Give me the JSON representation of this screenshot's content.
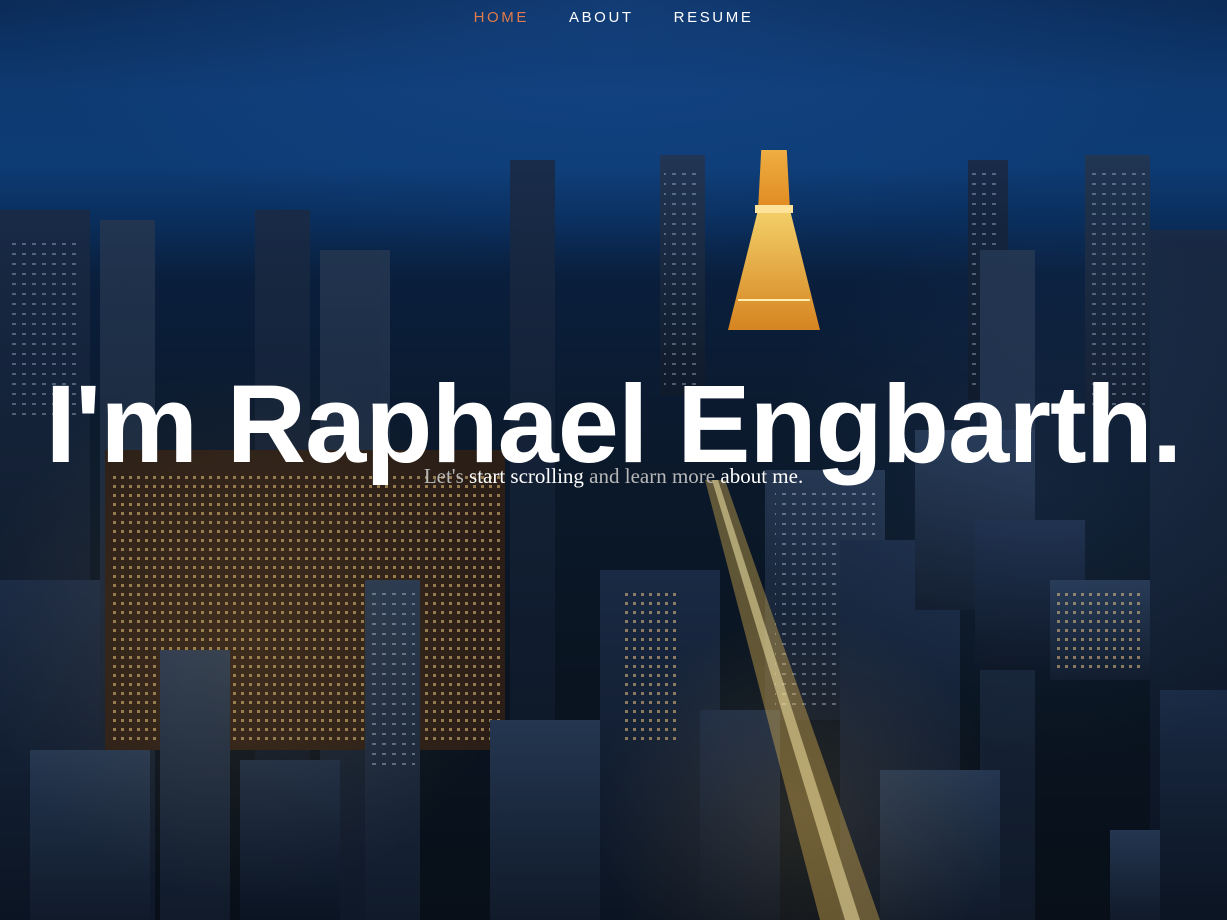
{
  "nav": {
    "items": [
      {
        "label": "HOME",
        "active": true
      },
      {
        "label": "ABOUT",
        "active": false
      },
      {
        "label": "RESUME",
        "active": false
      }
    ]
  },
  "hero": {
    "title": "I'm Raphael Engbarth.",
    "subtitle": {
      "part1": "Let's ",
      "link1": "start scrolling",
      "part2": " and learn more ",
      "link2": "about me",
      "part3": "."
    },
    "background_description_colors": {
      "sky_top": "#0b2b57",
      "sky_mid": "#0e3a72",
      "city_base": "#080f18",
      "tower_light": "#f0a020"
    }
  },
  "colors": {
    "nav_active": "#e07a4b",
    "nav_text": "#ffffff",
    "subtitle_muted": "#b8b8b8",
    "title": "#ffffff"
  }
}
